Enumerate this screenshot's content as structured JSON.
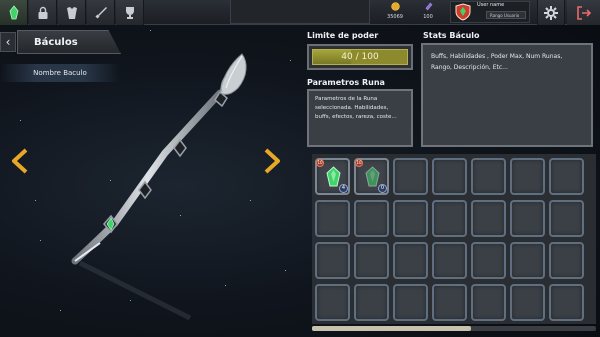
{
  "topbar": {
    "nav_icons": [
      "rune-icon",
      "lock-icon",
      "armor-icon",
      "sword-icon",
      "trophy-icon"
    ],
    "resources": [
      {
        "name": "gold-coin-icon",
        "value": "35069",
        "color": "#e8a826"
      },
      {
        "name": "crystal-icon",
        "value": "100",
        "color": "#8b6fd6"
      }
    ],
    "user": {
      "name": "User name",
      "rank": "Rango Usuario"
    },
    "settings_icon": "gear-icon",
    "exit_icon": "exit-icon"
  },
  "left": {
    "back_label": "‹",
    "title": "Báculos",
    "staff_name": "Nombre Baculo"
  },
  "right": {
    "limit_title": "Limite de poder",
    "limit_value": "40",
    "limit_max": "100",
    "limit_text": "40 / 100",
    "limit_fraction": 0.4,
    "rune_title": "Parametros Runa",
    "rune_text": "Parametros de la Runa seleccionada. Habilidades, buffs, efectos, rareza, coste...",
    "stats_title": "Stats Báculo",
    "stats_text": "Buffs, Habilidades , Poder Max, Num Runas, Rango, Descripción, Etc..."
  },
  "inventory": {
    "items": [
      {
        "slot": 0,
        "level": "10",
        "qty": "4",
        "dim": false
      },
      {
        "slot": 1,
        "level": "10",
        "qty": "0",
        "dim": true
      }
    ],
    "slot_count": 28,
    "scroll_fraction": 0.56
  },
  "colors": {
    "accent_gold": "#e8a826",
    "gem_green": "#3fd36a",
    "limit_bar": "#8d8a2d"
  }
}
